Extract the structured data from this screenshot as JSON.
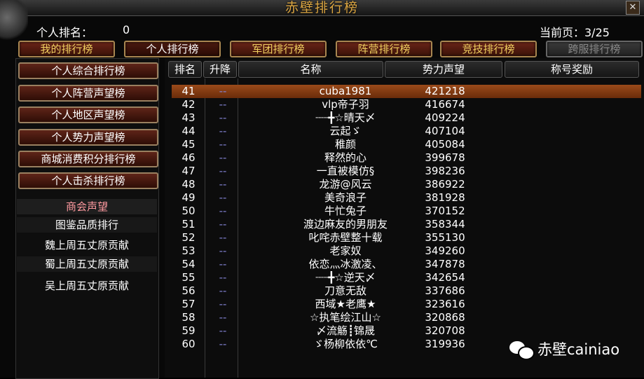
{
  "window": {
    "title": "赤壁排行榜",
    "close_glyph": "✕"
  },
  "header": {
    "rank_label": "个人排名：",
    "rank_value": "0",
    "page_label": "当前页：3/25"
  },
  "tabs": [
    {
      "label": "我的排行榜"
    },
    {
      "label": "个人排行榜"
    },
    {
      "label": "军团排行榜"
    },
    {
      "label": "阵营排行榜"
    },
    {
      "label": "竞技排行榜"
    },
    {
      "label": "跨服排行榜"
    }
  ],
  "sidebar": {
    "buttons": [
      {
        "label": "个人综合排行榜"
      },
      {
        "label": "个人阵营声望榜"
      },
      {
        "label": "个人地区声望榜"
      },
      {
        "label": "个人势力声望榜"
      },
      {
        "label": "商城消费积分排行榜"
      },
      {
        "label": "个人击杀排行榜"
      }
    ],
    "subitems": [
      {
        "label": "商会声望"
      },
      {
        "label": "图鉴品质排行"
      },
      {
        "label": "魏上周五丈原贡献"
      },
      {
        "label": "蜀上周五丈原贡献"
      },
      {
        "label": "吴上周五丈原贡献"
      }
    ]
  },
  "table": {
    "headers": {
      "rank": "排名",
      "change": "升降",
      "name": "名称",
      "power": "势力声望",
      "title": "称号奖励"
    },
    "rows": [
      {
        "rank": "41",
        "change": "--",
        "name": "cuba1981",
        "power": "421218",
        "title": ""
      },
      {
        "rank": "42",
        "change": "--",
        "name": "vlp帝子羽",
        "power": "416674",
        "title": ""
      },
      {
        "rank": "43",
        "change": "--",
        "name": "┈┈╋☆晴天〆",
        "power": "409224",
        "title": ""
      },
      {
        "rank": "44",
        "change": "--",
        "name": "云起ゞ",
        "power": "407104",
        "title": ""
      },
      {
        "rank": "45",
        "change": "--",
        "name": "稚颜",
        "power": "405084",
        "title": ""
      },
      {
        "rank": "46",
        "change": "--",
        "name": "释然的心",
        "power": "399678",
        "title": ""
      },
      {
        "rank": "47",
        "change": "--",
        "name": "一直被模仿§",
        "power": "398236",
        "title": ""
      },
      {
        "rank": "48",
        "change": "--",
        "name": "龙游@风云",
        "power": "386922",
        "title": ""
      },
      {
        "rank": "49",
        "change": "--",
        "name": "美奇浪子",
        "power": "381928",
        "title": ""
      },
      {
        "rank": "50",
        "change": "--",
        "name": "牛忙兔子",
        "power": "370152",
        "title": ""
      },
      {
        "rank": "51",
        "change": "--",
        "name": "渡边麻友的男朋友",
        "power": "358344",
        "title": ""
      },
      {
        "rank": "52",
        "change": "--",
        "name": "叱咤赤壁整十载",
        "power": "355130",
        "title": ""
      },
      {
        "rank": "53",
        "change": "--",
        "name": "老家奴",
        "power": "349260",
        "title": ""
      },
      {
        "rank": "54",
        "change": "--",
        "name": "依恋灬冰激凌、",
        "power": "347878",
        "title": ""
      },
      {
        "rank": "55",
        "change": "--",
        "name": "┈┈╋☆逆天〆",
        "power": "342654",
        "title": ""
      },
      {
        "rank": "56",
        "change": "--",
        "name": "刀意无敌",
        "power": "337686",
        "title": ""
      },
      {
        "rank": "57",
        "change": "--",
        "name": "西域★老鹰★",
        "power": "323616",
        "title": ""
      },
      {
        "rank": "58",
        "change": "--",
        "name": "☆执笔绘江山☆",
        "power": "320868",
        "title": ""
      },
      {
        "rank": "59",
        "change": "--",
        "name": "〆流觞┋锦晟",
        "power": "320708",
        "title": ""
      },
      {
        "rank": "60",
        "change": "--",
        "name": "ゞ杨柳依依℃",
        "power": "319936",
        "title": ""
      }
    ]
  },
  "watermark": {
    "text": "赤壁cainiao",
    "icon": "wechat-icon"
  }
}
